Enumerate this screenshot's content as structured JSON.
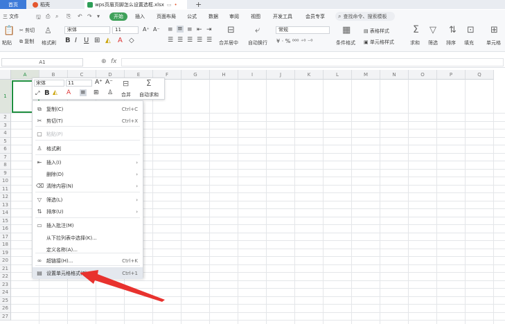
{
  "tabs": {
    "home": "首页",
    "daoke": "稻壳",
    "doc": "wps页眉页脚怎么设置选框.xlsx",
    "new_tab": "+"
  },
  "menu": {
    "file": "三 文件",
    "start": "开始",
    "insert": "插入",
    "page_layout": "页面布局",
    "formula": "公式",
    "data": "数据",
    "review": "审阅",
    "view": "视图",
    "devtools": "开发工具",
    "member": "会员专享",
    "search_placeholder": "查找命令、搜索模板"
  },
  "ribbon": {
    "paste": "粘贴",
    "cut": "剪切",
    "copy": "复制",
    "format_painter": "格式刷",
    "font_name": "宋体",
    "font_size": "11",
    "merge": "合并居中",
    "wrap": "自动换行",
    "number_format": "常规",
    "cond_format": "条件格式",
    "table_style": "表格样式",
    "cell_style": "单元格样式",
    "sum": "求和",
    "filter": "筛选",
    "sort": "排序",
    "fill": "填充",
    "cell": "单元格"
  },
  "formula_bar": {
    "name_box": "A1",
    "fx": "fx"
  },
  "grid": {
    "columns": [
      "A",
      "B",
      "C",
      "D",
      "E",
      "F",
      "G",
      "H",
      "I",
      "J",
      "K",
      "L",
      "M",
      "N",
      "O",
      "P",
      "Q"
    ],
    "rows": [
      "1",
      "2",
      "3",
      "4",
      "5",
      "6",
      "7",
      "8",
      "9",
      "10",
      "11",
      "12",
      "13",
      "14",
      "15",
      "16",
      "17",
      "18",
      "19",
      "20",
      "21",
      "22",
      "23",
      "24",
      "25",
      "26",
      "27"
    ]
  },
  "mini_toolbar": {
    "font_name": "宋体",
    "font_size": "11",
    "merge": "合并",
    "autosum": "自动求和"
  },
  "context_menu": {
    "items": [
      {
        "label": "复制(C)",
        "shortcut": "Ctrl+C",
        "icon": "copy-icon"
      },
      {
        "label": "剪切(T)",
        "shortcut": "Ctrl+X",
        "icon": "cut-icon"
      },
      {
        "label": "粘贴(P)",
        "shortcut": "",
        "icon": "paste-icon"
      },
      {
        "label": "格式刷",
        "shortcut": "",
        "icon": "format-painter-icon"
      },
      {
        "label": "插入(I)",
        "shortcut": "",
        "icon": "insert-icon"
      },
      {
        "label": "删除(D)",
        "shortcut": "",
        "icon": ""
      },
      {
        "label": "清除内容(N)",
        "shortcut": "",
        "icon": "eraser-icon"
      },
      {
        "label": "筛选(L)",
        "shortcut": "",
        "icon": "filter-icon"
      },
      {
        "label": "排序(U)",
        "shortcut": "",
        "icon": "sort-icon"
      },
      {
        "label": "插入批注(M)",
        "shortcut": "",
        "icon": "comment-icon"
      },
      {
        "label": "从下拉列表中选择(K)...",
        "shortcut": "",
        "icon": ""
      },
      {
        "label": "定义名称(A)...",
        "shortcut": "",
        "icon": ""
      },
      {
        "label": "超链接(H)...",
        "shortcut": "Ctrl+K",
        "icon": "link-icon"
      },
      {
        "label": "设置单元格格式(F)...",
        "shortcut": "Ctrl+1",
        "icon": "format-cells-icon"
      }
    ]
  },
  "colors": {
    "accent_green": "#3fa15a",
    "tab_blue": "#3d7bd9",
    "arrow_red": "#e8322e",
    "selection_green": "#1e8e3e"
  }
}
